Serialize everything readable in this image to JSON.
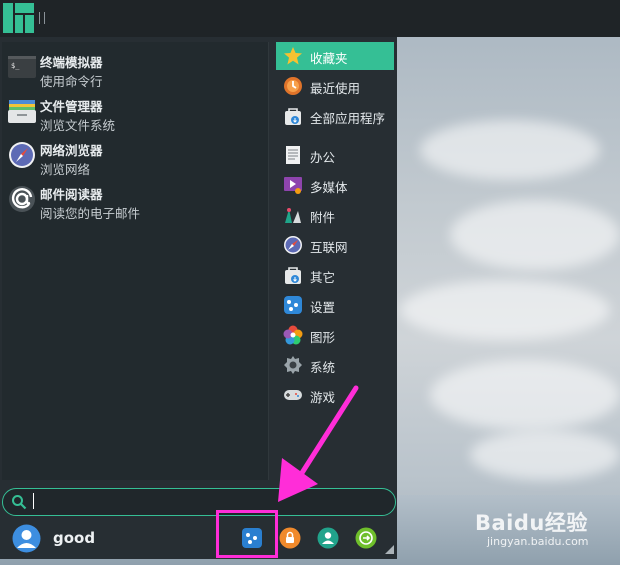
{
  "panel": {
    "logo_icon": "manjaro-logo-icon",
    "accent": "#35bf95"
  },
  "favorites": [
    {
      "title": "终端模拟器",
      "subtitle": "使用命令行",
      "icon": "terminal-icon"
    },
    {
      "title": "文件管理器",
      "subtitle": "浏览文件系统",
      "icon": "file-manager-icon"
    },
    {
      "title": "网络浏览器",
      "subtitle": "浏览网络",
      "icon": "web-browser-icon"
    },
    {
      "title": "邮件阅读器",
      "subtitle": "阅读您的电子邮件",
      "icon": "mail-icon"
    }
  ],
  "categories": [
    {
      "label": "收藏夹",
      "icon": "star-icon",
      "active": true
    },
    {
      "label": "最近使用",
      "icon": "clock-icon",
      "active": false
    },
    {
      "label": "全部应用程序",
      "icon": "apps-bag-icon",
      "active": false
    },
    {
      "label": "办公",
      "icon": "document-icon",
      "active": false
    },
    {
      "label": "多媒体",
      "icon": "multimedia-icon",
      "active": false
    },
    {
      "label": "附件",
      "icon": "accessories-icon",
      "active": false
    },
    {
      "label": "互联网",
      "icon": "compass-icon",
      "active": false
    },
    {
      "label": "其它",
      "icon": "other-bag-icon",
      "active": false
    },
    {
      "label": "设置",
      "icon": "settings-icon",
      "active": false
    },
    {
      "label": "图形",
      "icon": "graphics-icon",
      "active": false
    },
    {
      "label": "系统",
      "icon": "system-gear-icon",
      "active": false
    },
    {
      "label": "游戏",
      "icon": "gamepad-icon",
      "active": false
    }
  ],
  "search": {
    "value": "",
    "placeholder": ""
  },
  "user": {
    "name": "good"
  },
  "actions": [
    {
      "name": "settings-manager-button",
      "icon": "settings-manager-icon",
      "color": "#2a7fd0"
    },
    {
      "name": "lock-screen-button",
      "icon": "lock-icon",
      "color": "#f08a2c"
    },
    {
      "name": "switch-user-button",
      "icon": "user-switch-icon",
      "color": "#21a38b"
    },
    {
      "name": "logout-button",
      "icon": "logout-icon",
      "color": "#6fbf2b"
    }
  ],
  "annotation": {
    "highlight_color": "#ff2dd8"
  },
  "watermark": {
    "brand": "Baidu经验",
    "url": "jingyan.baidu.com"
  }
}
